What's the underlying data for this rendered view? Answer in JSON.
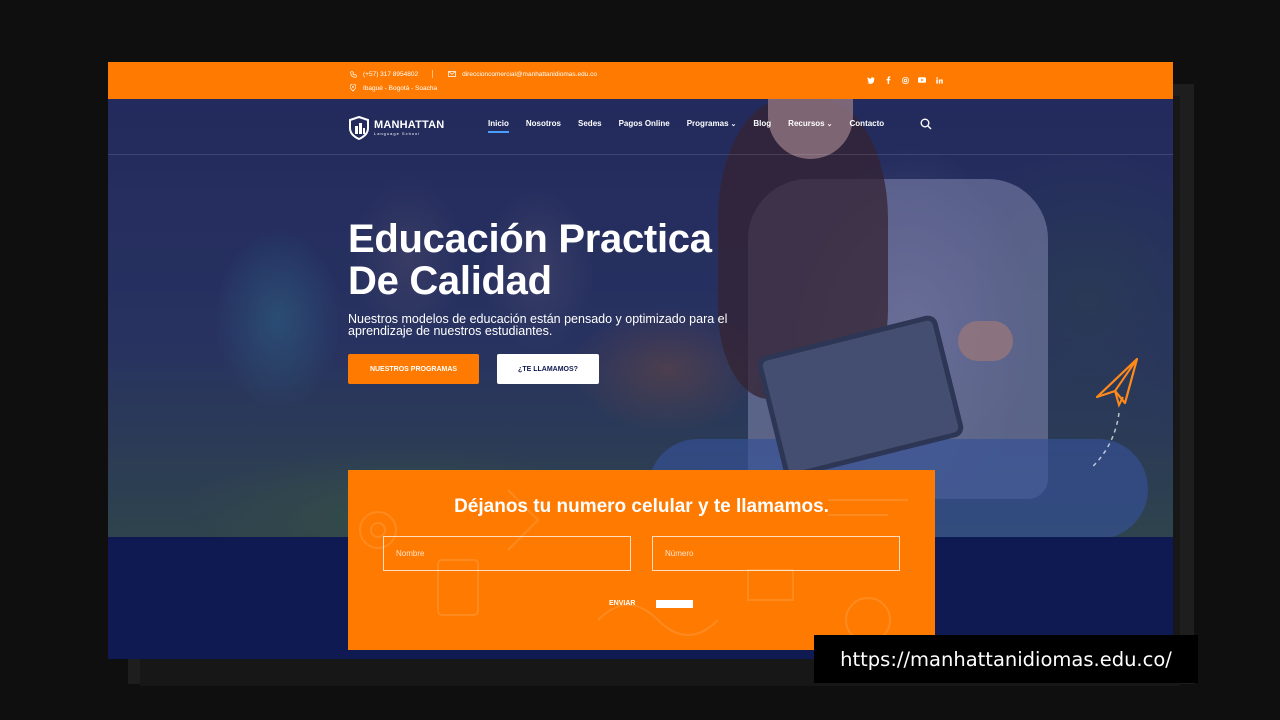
{
  "topbar": {
    "phone": "(+57) 317 8954802",
    "email": "direccioncomercial@manhattanidiomas.edu.co",
    "address": "Ibagué - Bogotá - Soacha",
    "social_icons": [
      "twitter-icon",
      "facebook-icon",
      "instagram-icon",
      "youtube-icon",
      "linkedin-icon"
    ],
    "bg_color": "#ff7a00"
  },
  "brand": {
    "name": "MANHATTAN",
    "tagline": "Language School"
  },
  "nav": {
    "items": [
      {
        "label": "Inicio",
        "active": true,
        "dropdown": false
      },
      {
        "label": "Nosotros",
        "active": false,
        "dropdown": false
      },
      {
        "label": "Sedes",
        "active": false,
        "dropdown": false
      },
      {
        "label": "Pagos Online",
        "active": false,
        "dropdown": false
      },
      {
        "label": "Programas",
        "active": false,
        "dropdown": true
      },
      {
        "label": "Blog",
        "active": false,
        "dropdown": false
      },
      {
        "label": "Recursos",
        "active": false,
        "dropdown": true
      },
      {
        "label": "Contacto",
        "active": false,
        "dropdown": false
      }
    ],
    "chevron": "⌄"
  },
  "hero": {
    "title_line1": "Educación Practica",
    "title_line2": "De Calidad",
    "subtitle": "Nuestros modelos de educación están pensado y optimizado para el aprendizaje de nuestros estudiantes.",
    "primary_button": "NUESTROS PROGRAMAS",
    "secondary_button": "¿TE LLAMAMOS?"
  },
  "callback": {
    "title": "Déjanos tu numero celular y te llamamos.",
    "name_placeholder": "Nombre",
    "number_placeholder": "Número",
    "submit_label": "ENVIAR"
  },
  "url_badge": "https://manhattanidiomas.edu.co/",
  "colors": {
    "accent": "#ff7a00",
    "navy": "#0f1a52",
    "active_underline": "#4a9eff"
  }
}
